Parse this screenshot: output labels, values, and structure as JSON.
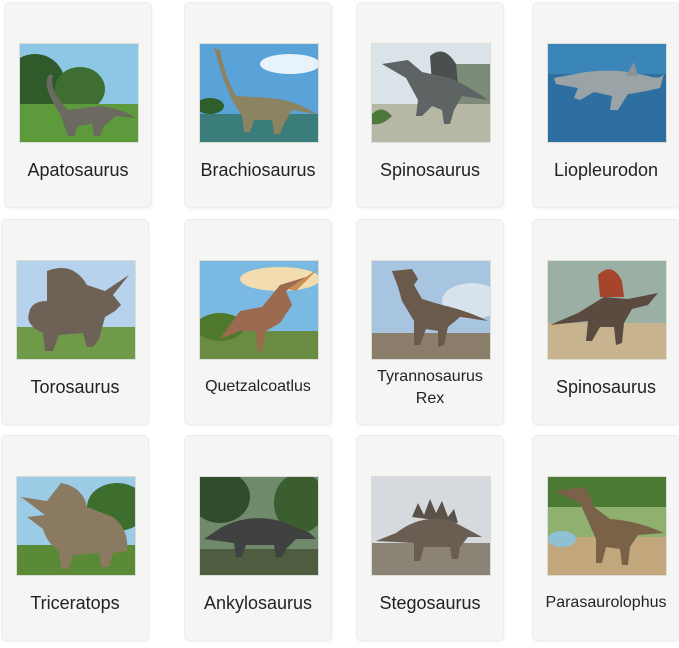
{
  "cards": [
    {
      "name": "Apatosaurus"
    },
    {
      "name": "Brachiosaurus"
    },
    {
      "name": "Spinosaurus"
    },
    {
      "name": "Liopleurodon"
    },
    {
      "name": "Torosaurus"
    },
    {
      "name": "Quetzalcoatlus"
    },
    {
      "name": "Tyrannosaurus\nRex"
    },
    {
      "name": "Spinosaurus"
    },
    {
      "name": "Triceratops"
    },
    {
      "name": "Ankylosaurus"
    },
    {
      "name": "Stegosaurus"
    },
    {
      "name": "Parasaurolophus"
    }
  ]
}
